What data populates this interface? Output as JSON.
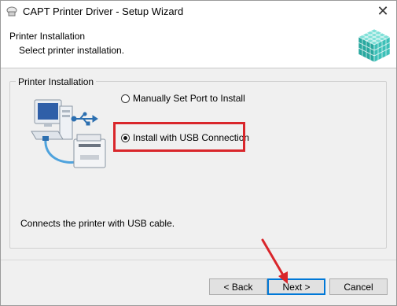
{
  "window": {
    "title": "CAPT Printer Driver - Setup Wizard",
    "close_symbol": "✕"
  },
  "header": {
    "title": "Printer Installation",
    "subtitle": "Select printer installation.",
    "logo_icon": "canon-cube-logo-icon"
  },
  "group": {
    "label": "Printer Installation",
    "illustration_icon": "computer-usb-printer-icon",
    "options": [
      {
        "label": "Manually Set Port to Install",
        "checked": false
      },
      {
        "label": "Install with USB Connection",
        "checked": true
      }
    ],
    "description": "Connects the printer with USB cable."
  },
  "buttons": {
    "back": "< Back",
    "next": "Next >",
    "cancel": "Cancel"
  },
  "colors": {
    "highlight": "#d9262b",
    "default_button_border": "#0078d7",
    "logo_teal": "#3cc0b8"
  }
}
